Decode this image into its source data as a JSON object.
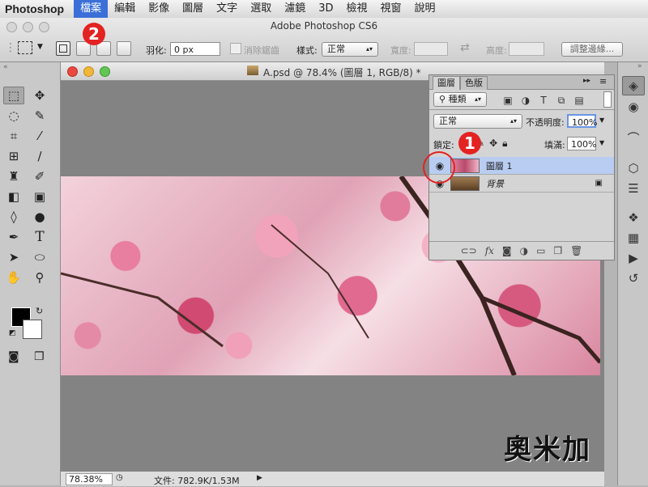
{
  "menu": {
    "app_name": "Photoshop",
    "items": [
      "檔案",
      "編輯",
      "影像",
      "圖層",
      "文字",
      "選取",
      "濾鏡",
      "3D",
      "檢視",
      "視窗",
      "說明"
    ],
    "active_index": 0
  },
  "window": {
    "title": "Adobe Photoshop CS6"
  },
  "options": {
    "feather_label": "羽化:",
    "feather_value": "0 px",
    "antialias_label": "消除鋸齒",
    "style_label": "樣式:",
    "style_value": "正常",
    "width_label": "寬度:",
    "height_label": "高度:",
    "refine_edge_button": "調整邊緣..."
  },
  "annotations": {
    "badge1": "1",
    "badge2": "2"
  },
  "document": {
    "title": "A.psd @ 78.4% (圖層 1, RGB/8) *",
    "zoom": "78.38%",
    "file_info": "文件: 782.9K/1.53M"
  },
  "layers_panel": {
    "tabs": [
      "圖層",
      "色版"
    ],
    "filter_kind": "種類",
    "blend_mode": "正常",
    "opacity_label": "不透明度:",
    "opacity_value": "100%",
    "lock_label": "鎖定:",
    "fill_label": "填滿:",
    "fill_value": "100%",
    "layers": [
      {
        "name": "圖層 1",
        "visible": true,
        "selected": true
      },
      {
        "name": "背景",
        "visible": true,
        "selected": false,
        "locked": true
      }
    ],
    "bottom_icons": [
      "link-icon",
      "fx-icon",
      "mask-icon",
      "adjustment-icon",
      "group-folder-icon",
      "new-layer-icon",
      "trash-icon"
    ]
  },
  "watermark": {
    "text": "奧米加"
  },
  "colors": {
    "menu_active": "#3a6fd8",
    "badge": "#e32222",
    "layer_selected": "#b9cdf2"
  }
}
